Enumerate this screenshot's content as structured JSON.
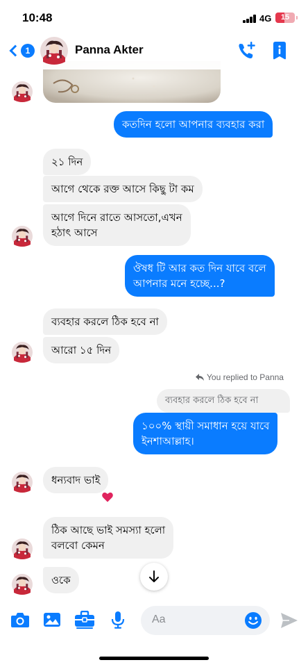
{
  "status_bar": {
    "time": "10:48",
    "network": "4G",
    "battery": "15",
    "battery_color": "#e5384d"
  },
  "header": {
    "back_count": "1",
    "contact_name": "Panna Akter",
    "icons": [
      "back-chevron-icon",
      "add-call-icon",
      "info-icon"
    ]
  },
  "messages": [
    {
      "side": "in",
      "text": "২১ দিন"
    },
    {
      "side": "in",
      "text": "আগে থেকে রক্ত আসে কিছু টা কম"
    },
    {
      "side": "in",
      "lines": [
        "আগে দিনে রাতে আসতো,এখন",
        "হঠাৎ আসে"
      ]
    },
    {
      "side": "in",
      "text": "ব্যবহার করলে ঠিক হবে না"
    },
    {
      "side": "in",
      "text": "আরো ১৫ দিন"
    },
    {
      "side": "in",
      "text": "ধন্যবাদ ভাই",
      "reaction": "heart"
    },
    {
      "side": "in",
      "lines": [
        "ঠিক আছে ভাই সমস্যা হলো",
        "বলবো কেমন"
      ]
    },
    {
      "side": "in",
      "text": "ওকে"
    }
  ],
  "sent_messages": [
    {
      "side": "out",
      "text": "কতদিন হলো আপনার ব্যবহার করা"
    },
    {
      "side": "out",
      "lines": [
        "ঔষধ টি আর কত দিন যাবে বলে",
        "আপনার মনে হচ্ছে...?"
      ]
    },
    {
      "side": "out",
      "lines": [
        "১০০% স্থায়ী সমাধান হয়ে যাবে",
        "ইনশাআল্লাহ।"
      ]
    }
  ],
  "reply": {
    "label": "You replied to Panna",
    "quoted_text": "ব্যবহার করলে ঠিক হবে না"
  },
  "composer": {
    "placeholder": "Aa",
    "icons": [
      "camera-icon",
      "gallery-icon",
      "briefcase-icon",
      "microphone-icon",
      "emoji-icon",
      "send-icon"
    ]
  },
  "colors": {
    "accent": "#0a7cff",
    "incoming_bubble": "#f0f0f0",
    "heart": "#e0245e"
  }
}
